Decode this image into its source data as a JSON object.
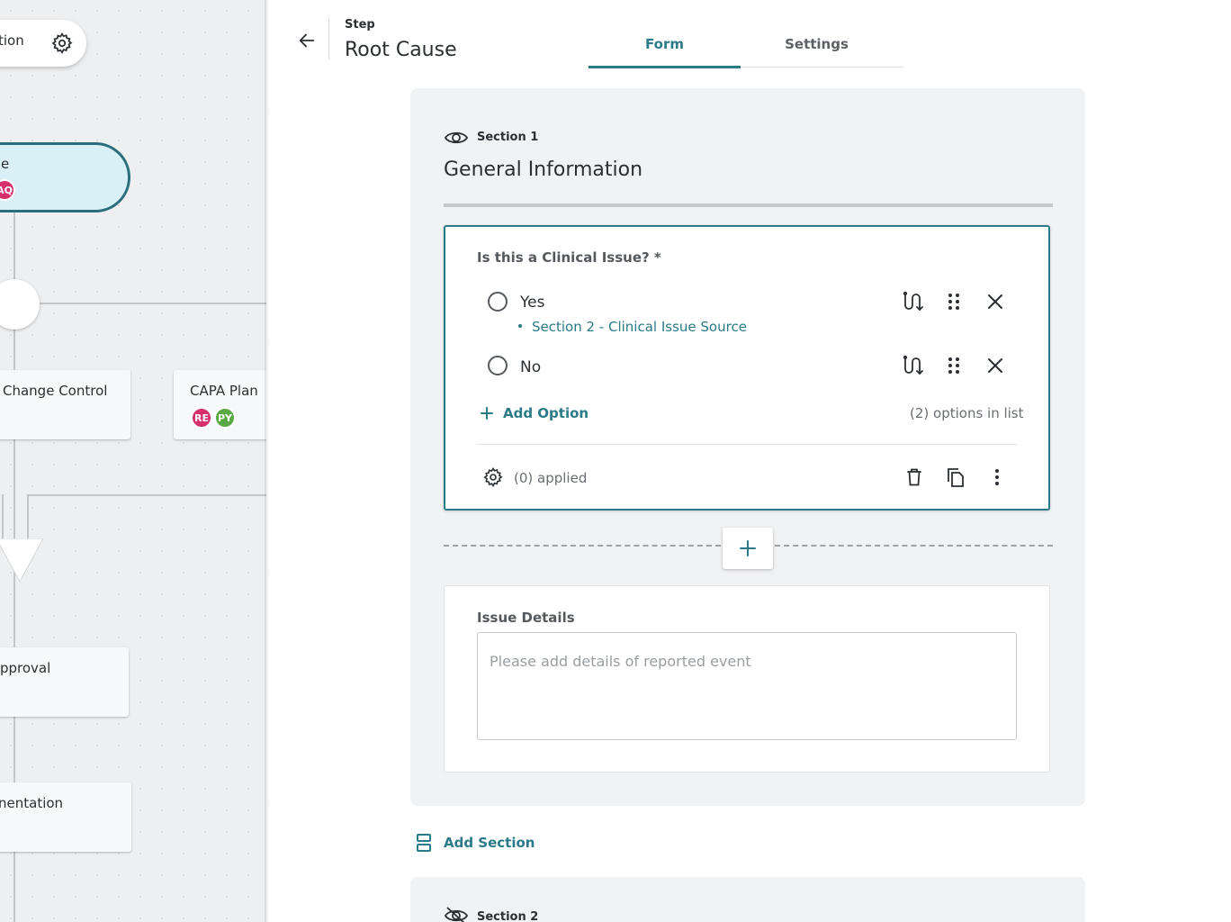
{
  "canvas": {
    "top_node_label": "tion",
    "selected_node_label": "e",
    "selected_node_badge": "AQ",
    "nodes": [
      {
        "label": "Change Control"
      },
      {
        "label": "CAPA Plan",
        "badges": [
          {
            "text": "RE",
            "color": "#d62f6c"
          },
          {
            "text": "PY",
            "color": "#5aa845"
          }
        ]
      },
      {
        "label": "pproval"
      },
      {
        "label": "nentation"
      }
    ]
  },
  "header": {
    "step_caption": "Step",
    "step_title": "Root Cause",
    "tabs": [
      {
        "label": "Form",
        "active": true
      },
      {
        "label": "Settings",
        "active": false
      }
    ]
  },
  "section1": {
    "caption": "Section 1",
    "title": "General Information",
    "visibility_icon": "eye-icon",
    "question": {
      "label": "Is this a Clinical Issue? *",
      "options": [
        {
          "label": "Yes",
          "branch": "Section 2 - Clinical Issue Source"
        },
        {
          "label": "No"
        }
      ],
      "add_option_label": "Add Option",
      "options_count": "(2) options in list",
      "applied_label": "(0) applied"
    },
    "details": {
      "label": "Issue Details",
      "placeholder": "Please add details of reported event"
    }
  },
  "add_section_label": "Add Section",
  "section2": {
    "caption": "Section 2",
    "visibility_icon": "eye-off-icon"
  },
  "colors": {
    "accent": "#2b7a87",
    "selected_node_fill": "#d9f0f6",
    "panel_bg": "#f1f2f3"
  }
}
